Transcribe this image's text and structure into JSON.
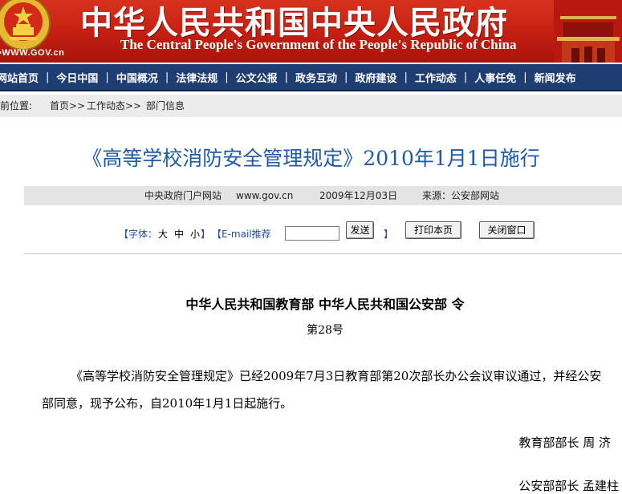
{
  "banner": {
    "url_text": "▪WWW.GOV.cn",
    "title_cn": "中华人民共和国中央人民政府",
    "title_en": "The Central People's Government of the People's Republic of China"
  },
  "nav": {
    "items": [
      "网站首页",
      "今日中国",
      "中国概况",
      "法律法规",
      "公文公报",
      "政务互动",
      "政府建设",
      "工作动态",
      "人事任免",
      "新闻发布"
    ],
    "separator": "|"
  },
  "breadcrumb": {
    "prefix": "当前位置:",
    "items": [
      "首页>>",
      "工作动态>>",
      "部门信息"
    ]
  },
  "article": {
    "title": "《高等学校消防安全管理规定》2010年1月1日施行",
    "source_site": "中央政府门户网站",
    "site_url": "www.gov.cn",
    "date": "2009年12月03日",
    "source": "来源：公安部网站"
  },
  "tools": {
    "font_label": "【字体：",
    "font_large": "大",
    "font_medium": "中",
    "font_small": "小",
    "font_close": "】",
    "email_label": "【E-mail推荐",
    "send_button": "发送",
    "email_close": "】",
    "print_button": "打印本页",
    "close_button": "关闭窗口"
  },
  "body": {
    "order_title": "中华人民共和国教育部  中华人民共和国公安部  令",
    "order_number": "第28号",
    "paragraph": "《高等学校消防安全管理规定》已经2009年7月3日教育部第20次部长办公会议审议通过，并经公安部同意，现予公布，自2010年1月1日起施行。",
    "signature_1": "教育部部长  周  济",
    "signature_2": "公安部部长  孟建柱"
  },
  "colors": {
    "banner_red": "#c41e12",
    "nav_blue": "#1e3d72",
    "title_blue": "#1d5aa8",
    "tool_blue": "#1e4fa0"
  }
}
